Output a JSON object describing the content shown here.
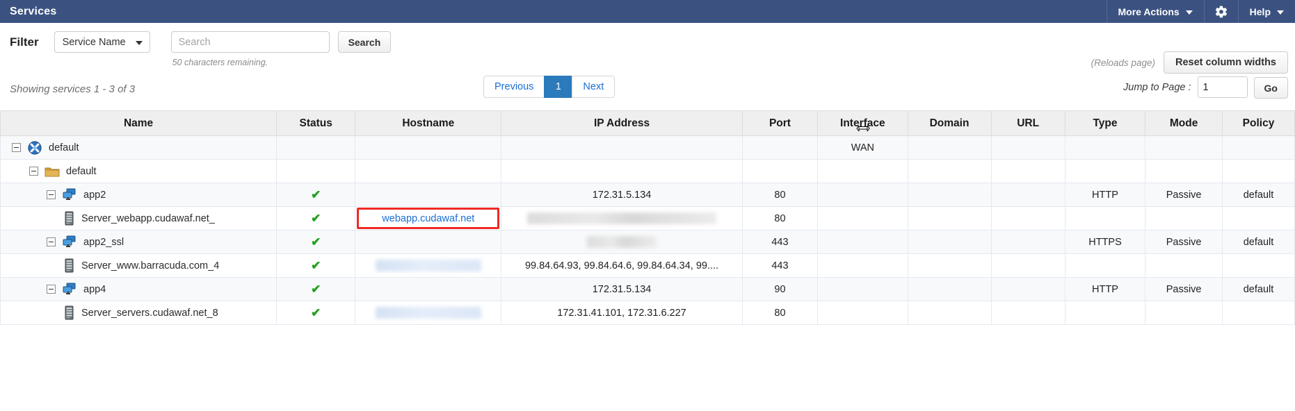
{
  "header": {
    "title": "Services",
    "more_actions_label": "More Actions",
    "help_label": "Help",
    "gear_icon": "gear-icon",
    "accent_color": "#3b5281"
  },
  "filter": {
    "label": "Filter",
    "field_selector_value": "Service Name",
    "search_placeholder": "Search",
    "search_value": "",
    "search_button_label": "Search",
    "chars_remaining": "50 characters remaining."
  },
  "column_tools": {
    "reloads_note": "(Reloads page)",
    "reset_button_label": "Reset column widths"
  },
  "paging": {
    "showing_text": "Showing services 1 - 3 of 3",
    "previous_label": "Previous",
    "current_page": "1",
    "next_label": "Next",
    "jump_label": "Jump to Page :",
    "jump_value": "1",
    "go_label": "Go"
  },
  "table": {
    "columns": [
      "Name",
      "Status",
      "Hostname",
      "IP Address",
      "Port",
      "Interface",
      "Domain",
      "URL",
      "Type",
      "Mode",
      "Policy"
    ],
    "rows": [
      {
        "name": "default",
        "indent": 0,
        "expandable": true,
        "icon": "cluster-icon",
        "status": "",
        "hostname": "",
        "ip_address": "",
        "port": "",
        "interface": "WAN",
        "domain": "",
        "url": "",
        "type": "",
        "mode": "",
        "policy": ""
      },
      {
        "name": "default",
        "indent": 1,
        "expandable": true,
        "icon": "folder-icon",
        "status": "",
        "hostname": "",
        "ip_address": "",
        "port": "",
        "interface": "",
        "domain": "",
        "url": "",
        "type": "",
        "mode": "",
        "policy": ""
      },
      {
        "name": "app2",
        "indent": 2,
        "expandable": true,
        "icon": "service-icon",
        "status": "ok",
        "hostname": "",
        "ip_address": "172.31.5.134",
        "port": "80",
        "interface": "",
        "domain": "",
        "url": "",
        "type": "HTTP",
        "mode": "Passive",
        "policy": "default"
      },
      {
        "name": "Server_webapp.cudawaf.net_",
        "indent": 3,
        "expandable": false,
        "icon": "server-icon",
        "status": "ok",
        "hostname": "webapp.cudawaf.net",
        "hostname_is_link": true,
        "hostname_highlighted": true,
        "ip_address": "",
        "ip_redacted": true,
        "port": "80",
        "interface": "",
        "domain": "",
        "url": "",
        "type": "",
        "mode": "",
        "policy": ""
      },
      {
        "name": "app2_ssl",
        "indent": 2,
        "expandable": true,
        "icon": "service-icon",
        "status": "ok",
        "hostname": "",
        "ip_address": "",
        "ip_redacted": true,
        "port": "443",
        "interface": "",
        "domain": "",
        "url": "",
        "type": "HTTPS",
        "mode": "Passive",
        "policy": "default"
      },
      {
        "name": "Server_www.barracuda.com_4",
        "indent": 3,
        "expandable": false,
        "icon": "server-icon",
        "status": "ok",
        "hostname": "",
        "hostname_redacted": true,
        "ip_address": "99.84.64.93, 99.84.64.6, 99.84.64.34, 99....",
        "port": "443",
        "interface": "",
        "domain": "",
        "url": "",
        "type": "",
        "mode": "",
        "policy": ""
      },
      {
        "name": "app4",
        "indent": 2,
        "expandable": true,
        "icon": "service-icon",
        "status": "ok",
        "hostname": "",
        "ip_address": "172.31.5.134",
        "port": "90",
        "interface": "",
        "domain": "",
        "url": "",
        "type": "HTTP",
        "mode": "Passive",
        "policy": "default"
      },
      {
        "name": "Server_servers.cudawaf.net_8",
        "indent": 3,
        "expandable": false,
        "icon": "server-icon",
        "status": "ok",
        "hostname": "",
        "hostname_redacted": true,
        "ip_address": "172.31.41.101, 172.31.6.227",
        "port": "80",
        "interface": "",
        "domain": "",
        "url": "",
        "type": "",
        "mode": "",
        "policy": ""
      }
    ]
  },
  "colors": {
    "status_ok": "#23a121",
    "link": "#1a6fd4",
    "highlight_box": "#ef2a23",
    "active_page": "#2a7abc"
  }
}
